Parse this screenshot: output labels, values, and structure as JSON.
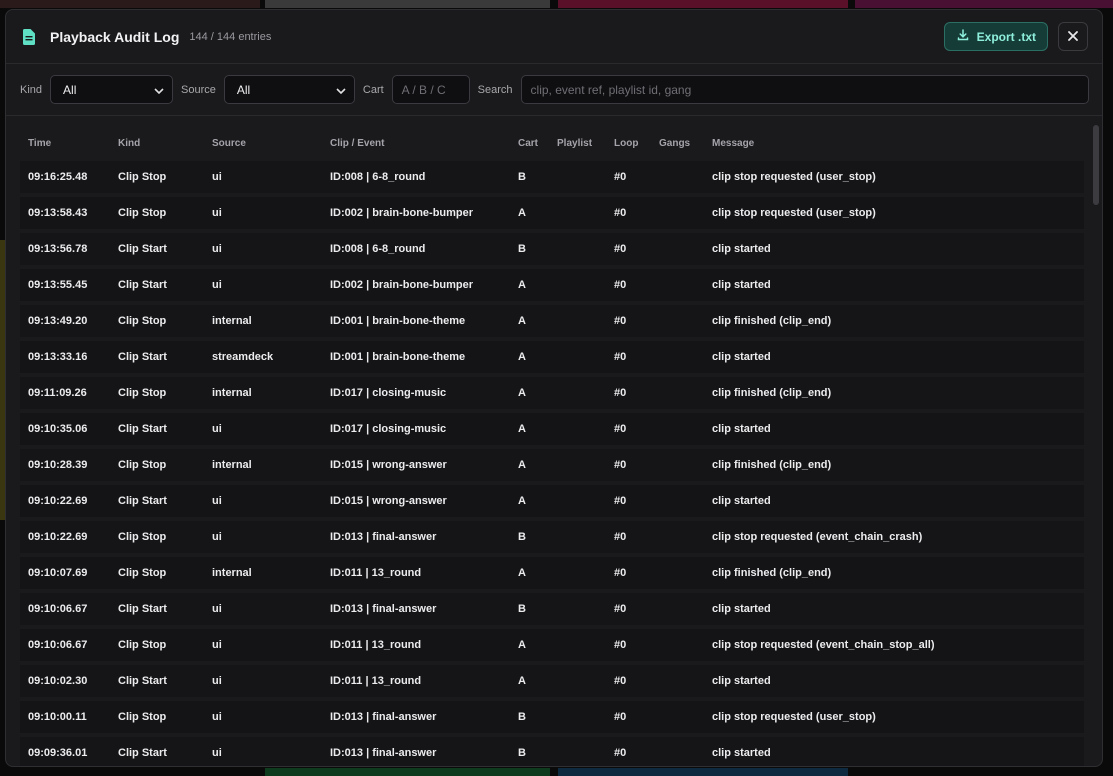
{
  "header": {
    "title": "Playback Audit Log",
    "count": "144 / 144 entries",
    "export_label": "Export .txt",
    "export_icon": "download-icon",
    "close_icon": "close-icon"
  },
  "filters": {
    "kind_label": "Kind",
    "kind_value": "All",
    "source_label": "Source",
    "source_value": "All",
    "cart_label": "Cart",
    "cart_placeholder": "A / B / C",
    "search_label": "Search",
    "search_placeholder": "clip, event ref, playlist id, gang"
  },
  "columns": [
    "Time",
    "Kind",
    "Source",
    "Clip / Event",
    "Cart",
    "Playlist",
    "Loop",
    "Gangs",
    "Message"
  ],
  "rows": [
    {
      "time": "09:16:25.48",
      "kind": "Clip Stop",
      "source": "ui",
      "clip": "ID:008 | 6-8_round",
      "cart": "B",
      "playlist": "",
      "loop": "#0",
      "gangs": "",
      "message": "clip stop requested (user_stop)"
    },
    {
      "time": "09:13:58.43",
      "kind": "Clip Stop",
      "source": "ui",
      "clip": "ID:002 | brain-bone-bumper",
      "cart": "A",
      "playlist": "",
      "loop": "#0",
      "gangs": "",
      "message": "clip stop requested (user_stop)"
    },
    {
      "time": "09:13:56.78",
      "kind": "Clip Start",
      "source": "ui",
      "clip": "ID:008 | 6-8_round",
      "cart": "B",
      "playlist": "",
      "loop": "#0",
      "gangs": "",
      "message": "clip started"
    },
    {
      "time": "09:13:55.45",
      "kind": "Clip Start",
      "source": "ui",
      "clip": "ID:002 | brain-bone-bumper",
      "cart": "A",
      "playlist": "",
      "loop": "#0",
      "gangs": "",
      "message": "clip started"
    },
    {
      "time": "09:13:49.20",
      "kind": "Clip Stop",
      "source": "internal",
      "clip": "ID:001 | brain-bone-theme",
      "cart": "A",
      "playlist": "",
      "loop": "#0",
      "gangs": "",
      "message": "clip finished (clip_end)"
    },
    {
      "time": "09:13:33.16",
      "kind": "Clip Start",
      "source": "streamdeck",
      "clip": "ID:001 | brain-bone-theme",
      "cart": "A",
      "playlist": "",
      "loop": "#0",
      "gangs": "",
      "message": "clip started"
    },
    {
      "time": "09:11:09.26",
      "kind": "Clip Stop",
      "source": "internal",
      "clip": "ID:017 | closing-music",
      "cart": "A",
      "playlist": "",
      "loop": "#0",
      "gangs": "",
      "message": "clip finished (clip_end)"
    },
    {
      "time": "09:10:35.06",
      "kind": "Clip Start",
      "source": "ui",
      "clip": "ID:017 | closing-music",
      "cart": "A",
      "playlist": "",
      "loop": "#0",
      "gangs": "",
      "message": "clip started"
    },
    {
      "time": "09:10:28.39",
      "kind": "Clip Stop",
      "source": "internal",
      "clip": "ID:015 | wrong-answer",
      "cart": "A",
      "playlist": "",
      "loop": "#0",
      "gangs": "",
      "message": "clip finished (clip_end)"
    },
    {
      "time": "09:10:22.69",
      "kind": "Clip Start",
      "source": "ui",
      "clip": "ID:015 | wrong-answer",
      "cart": "A",
      "playlist": "",
      "loop": "#0",
      "gangs": "",
      "message": "clip started"
    },
    {
      "time": "09:10:22.69",
      "kind": "Clip Stop",
      "source": "ui",
      "clip": "ID:013 | final-answer",
      "cart": "B",
      "playlist": "",
      "loop": "#0",
      "gangs": "",
      "message": "clip stop requested (event_chain_crash)"
    },
    {
      "time": "09:10:07.69",
      "kind": "Clip Stop",
      "source": "internal",
      "clip": "ID:011 | 13_round",
      "cart": "A",
      "playlist": "",
      "loop": "#0",
      "gangs": "",
      "message": "clip finished (clip_end)"
    },
    {
      "time": "09:10:06.67",
      "kind": "Clip Start",
      "source": "ui",
      "clip": "ID:013 | final-answer",
      "cart": "B",
      "playlist": "",
      "loop": "#0",
      "gangs": "",
      "message": "clip started"
    },
    {
      "time": "09:10:06.67",
      "kind": "Clip Stop",
      "source": "ui",
      "clip": "ID:011 | 13_round",
      "cart": "A",
      "playlist": "",
      "loop": "#0",
      "gangs": "",
      "message": "clip stop requested (event_chain_stop_all)"
    },
    {
      "time": "09:10:02.30",
      "kind": "Clip Start",
      "source": "ui",
      "clip": "ID:011 | 13_round",
      "cart": "A",
      "playlist": "",
      "loop": "#0",
      "gangs": "",
      "message": "clip started"
    },
    {
      "time": "09:10:00.11",
      "kind": "Clip Stop",
      "source": "ui",
      "clip": "ID:013 | final-answer",
      "cart": "B",
      "playlist": "",
      "loop": "#0",
      "gangs": "",
      "message": "clip stop requested (user_stop)"
    },
    {
      "time": "09:09:36.01",
      "kind": "Clip Start",
      "source": "ui",
      "clip": "ID:013 | final-answer",
      "cart": "B",
      "playlist": "",
      "loop": "#0",
      "gangs": "",
      "message": "clip started"
    }
  ],
  "colors": {
    "accent": "#8ef0dc",
    "export_bg": "#163c37",
    "panel_bg": "#1a1a1c",
    "row_bg": "#141416"
  }
}
